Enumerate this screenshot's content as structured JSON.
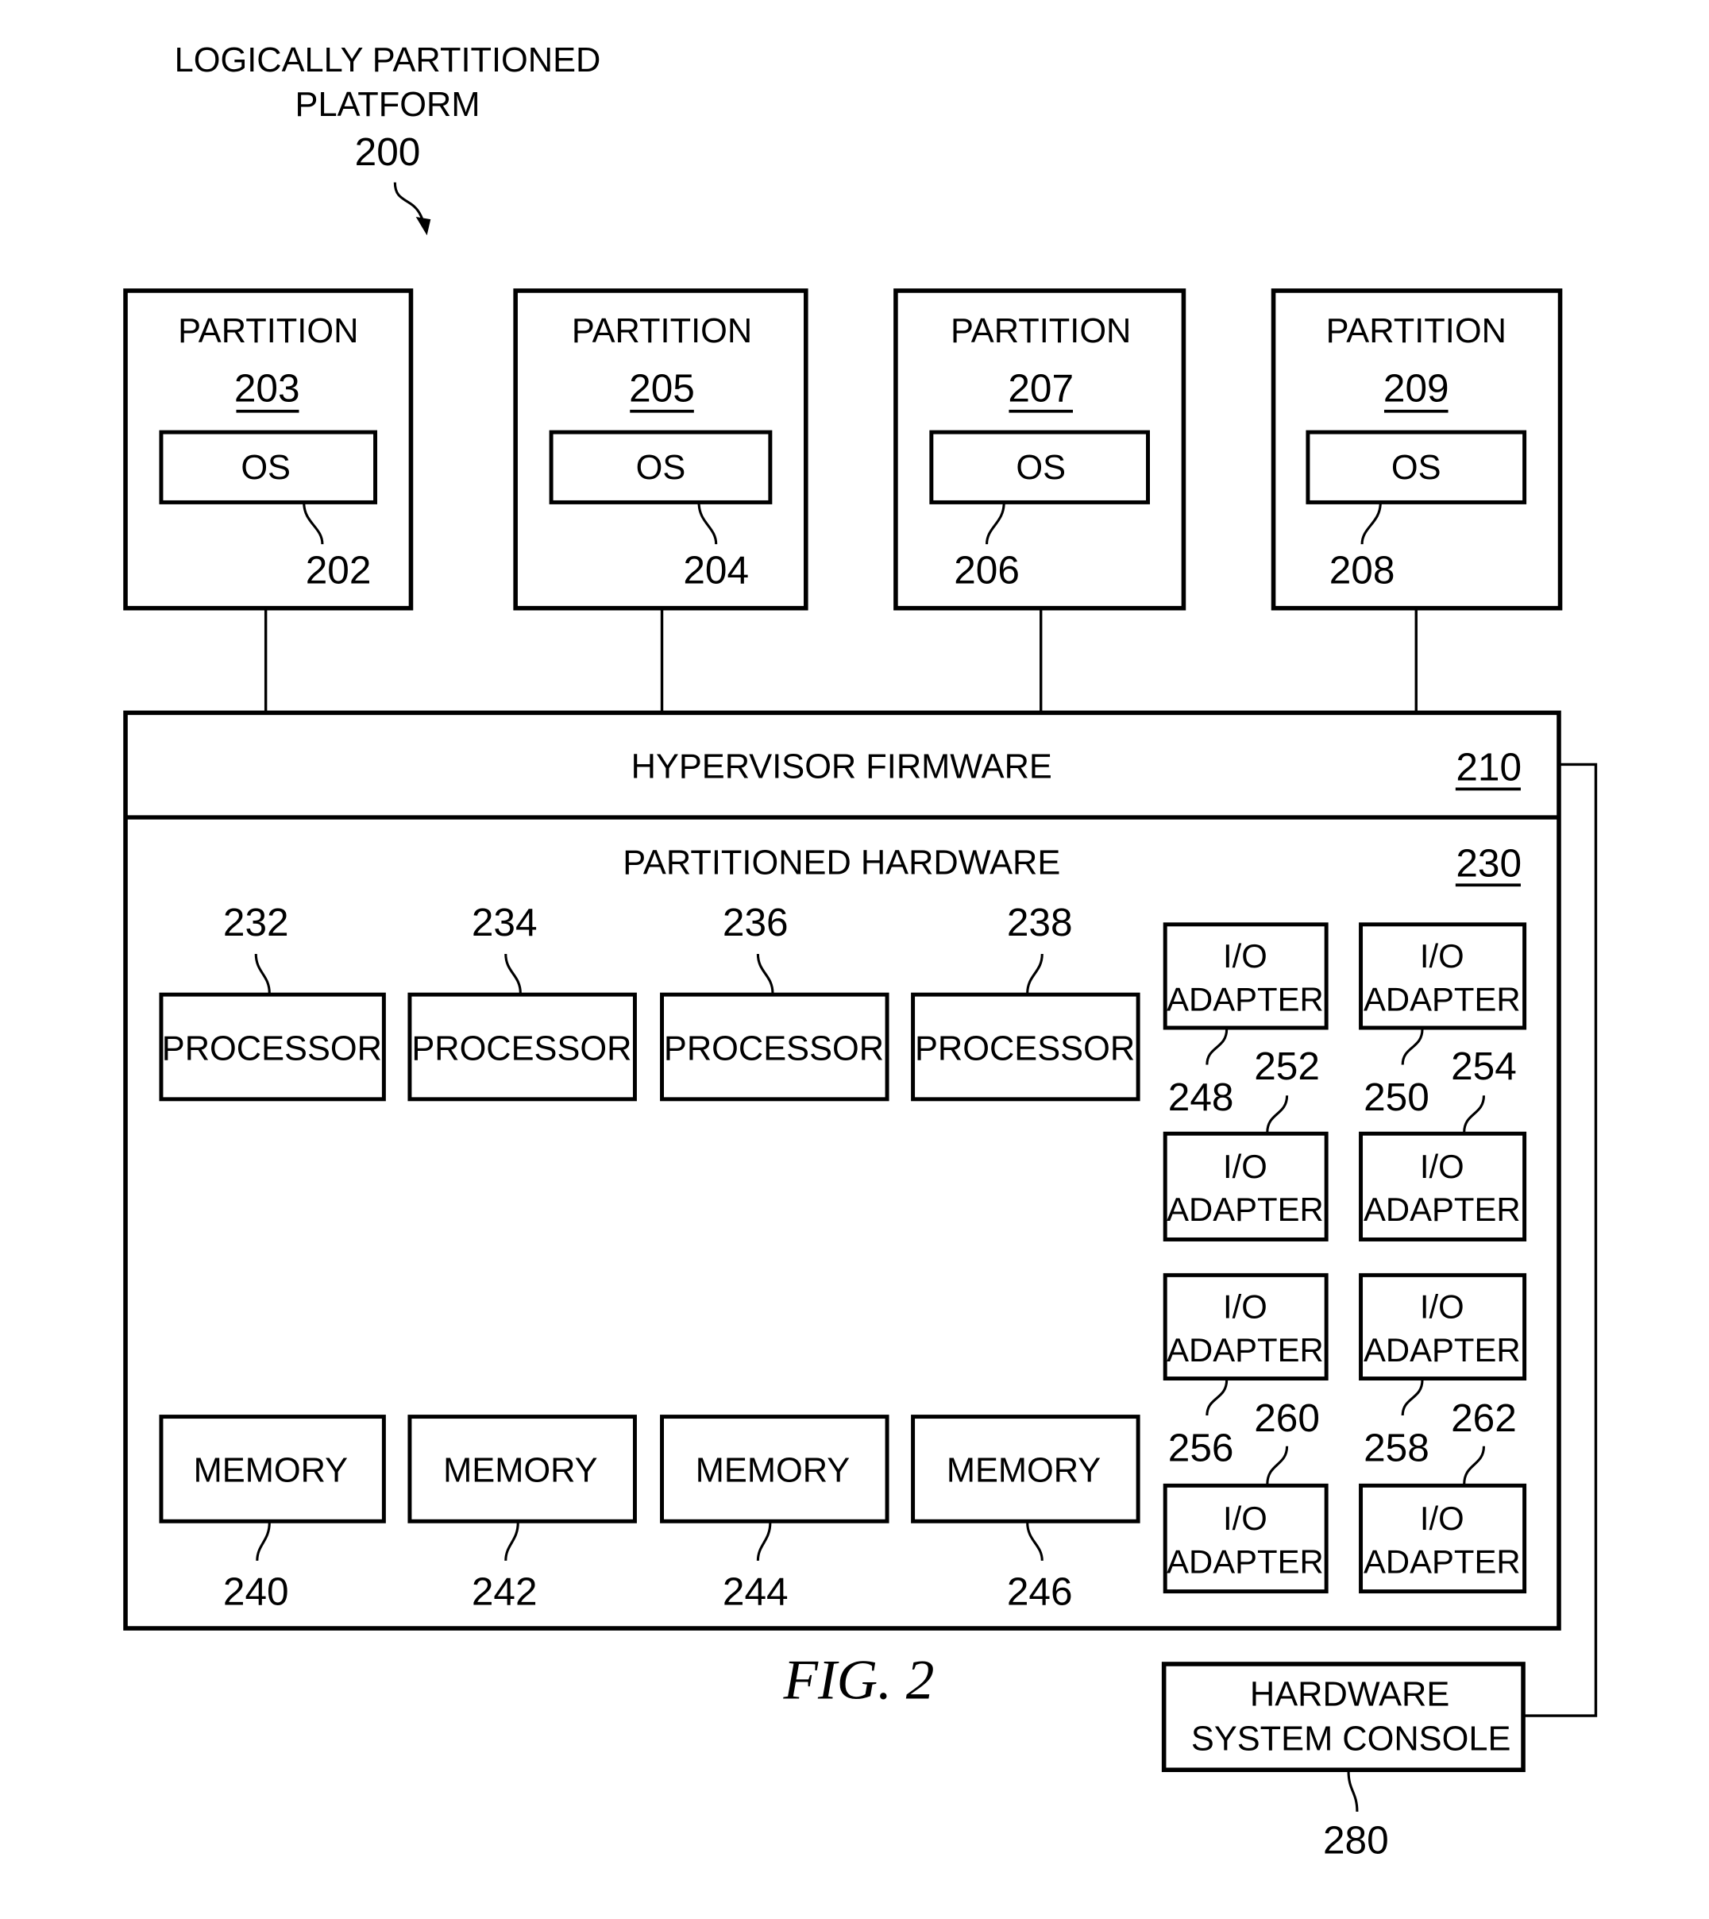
{
  "title": {
    "line1": "LOGICALLY PARTITIONED",
    "line2": "PLATFORM",
    "ref": "200"
  },
  "partitions": [
    {
      "label": "PARTITION",
      "ref": "203",
      "os_label": "OS",
      "os_ref": "202"
    },
    {
      "label": "PARTITION",
      "ref": "205",
      "os_label": "OS",
      "os_ref": "204"
    },
    {
      "label": "PARTITION",
      "ref": "207",
      "os_label": "OS",
      "os_ref": "206"
    },
    {
      "label": "PARTITION",
      "ref": "209",
      "os_label": "OS",
      "os_ref": "208"
    }
  ],
  "hypervisor": {
    "label": "HYPERVISOR FIRMWARE",
    "ref": "210"
  },
  "hardware": {
    "label": "PARTITIONED HARDWARE",
    "ref": "230"
  },
  "processors": [
    {
      "label": "PROCESSOR",
      "ref": "232"
    },
    {
      "label": "PROCESSOR",
      "ref": "234"
    },
    {
      "label": "PROCESSOR",
      "ref": "236"
    },
    {
      "label": "PROCESSOR",
      "ref": "238"
    }
  ],
  "memories": [
    {
      "label": "MEMORY",
      "ref": "240"
    },
    {
      "label": "MEMORY",
      "ref": "242"
    },
    {
      "label": "MEMORY",
      "ref": "244"
    },
    {
      "label": "MEMORY",
      "ref": "246"
    }
  ],
  "io_adapters": [
    {
      "line1": "I/O",
      "line2": "ADAPTER",
      "ref": "248"
    },
    {
      "line1": "I/O",
      "line2": "ADAPTER",
      "ref": "250"
    },
    {
      "line1": "I/O",
      "line2": "ADAPTER",
      "ref": "252"
    },
    {
      "line1": "I/O",
      "line2": "ADAPTER",
      "ref": "254"
    },
    {
      "line1": "I/O",
      "line2": "ADAPTER",
      "ref": "256"
    },
    {
      "line1": "I/O",
      "line2": "ADAPTER",
      "ref": "258"
    },
    {
      "line1": "I/O",
      "line2": "ADAPTER",
      "ref": "260"
    },
    {
      "line1": "I/O",
      "line2": "ADAPTER",
      "ref": "262"
    }
  ],
  "console": {
    "line1": "HARDWARE",
    "line2": "SYSTEM CONSOLE",
    "ref": "280"
  },
  "figure_caption": "FIG. 2"
}
